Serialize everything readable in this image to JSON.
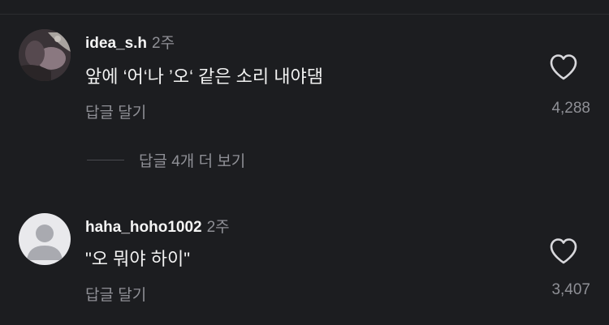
{
  "comments": [
    {
      "username": "idea_s.h",
      "time": "2주",
      "text": "앞에 ‘어‘나 ’오‘ 같은 소리 내야댐",
      "reply_label": "답글 달기",
      "likes": "4,288",
      "avatar": "photo"
    },
    {
      "username": "haha_hoho1002",
      "time": "2주",
      "text": "\"오 뭐야 하이\"",
      "reply_label": "답글 달기",
      "likes": "3,407",
      "avatar": "default"
    }
  ],
  "more_replies": {
    "label": "답글 4개 더 보기"
  },
  "icons": {
    "like": "heart-outline-icon",
    "default_avatar": "user-silhouette-icon"
  },
  "colors": {
    "background": "#1c1d20",
    "primary_text": "#f2f2f2",
    "secondary_text": "#8f9096"
  }
}
